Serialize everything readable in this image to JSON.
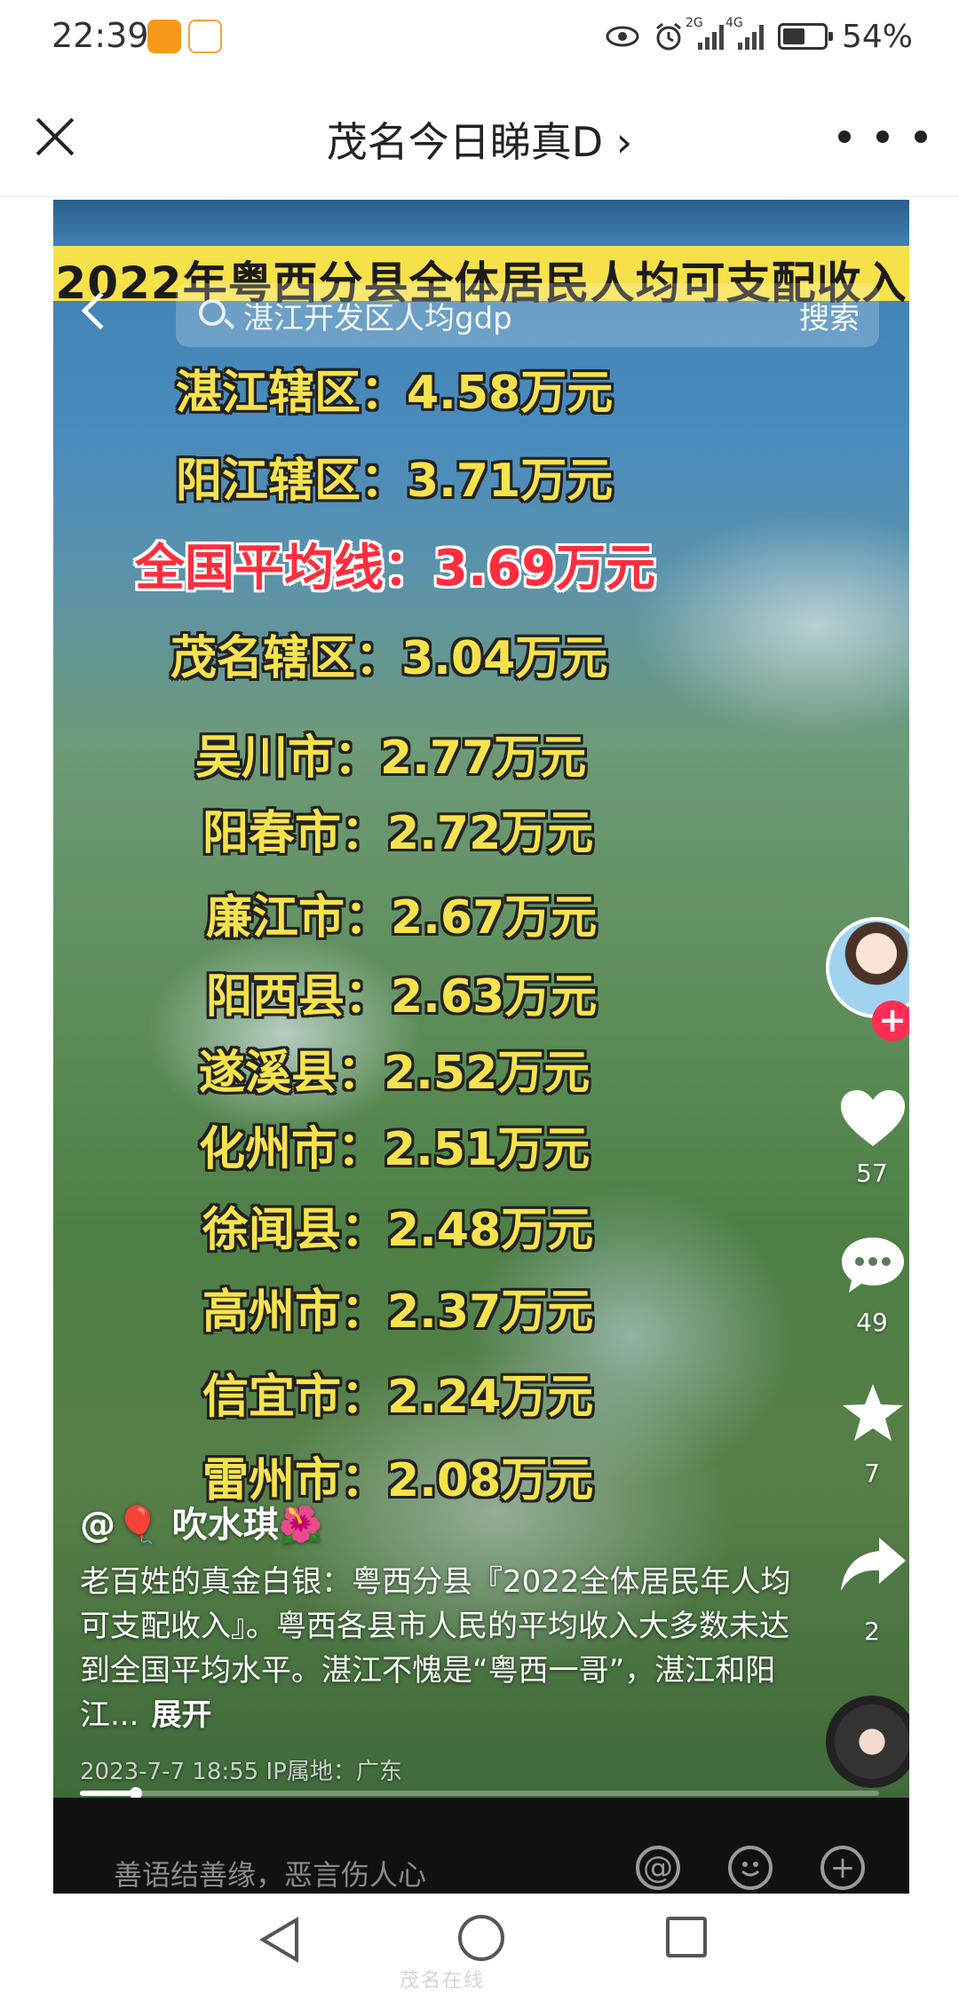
{
  "status_bar": {
    "time": "22:39",
    "network": "2G",
    "network2": "4G",
    "battery_text": "54%",
    "battery_level": 0.54
  },
  "title_bar": {
    "title": "茂名今日睇真D ›"
  },
  "video": {
    "banner": "2022年粤西分县全体居民人均可支配收入",
    "search": {
      "placeholder": "湛江开发区人均gdp",
      "button": "搜索"
    },
    "rankings": [
      {
        "label": "湛江辖区：4.58万元"
      },
      {
        "label": "阳江辖区：3.71万元"
      },
      {
        "label": "全国平均线：3.69万元",
        "highlight": true
      },
      {
        "label": "茂名辖区：3.04万元"
      },
      {
        "label": "吴川市：2.77万元"
      },
      {
        "label": "阳春市：2.72万元"
      },
      {
        "label": "廉江市：2.67万元"
      },
      {
        "label": "阳西县：2.63万元"
      },
      {
        "label": "遂溪县：2.52万元"
      },
      {
        "label": "化州市：2.51万元"
      },
      {
        "label": "徐闻县：2.48万元"
      },
      {
        "label": "高州市：2.37万元"
      },
      {
        "label": "信宜市：2.24万元"
      },
      {
        "label": "雷州市：2.08万元"
      }
    ],
    "actions": {
      "likes": "57",
      "comments": "49",
      "favorites": "7",
      "shares": "2"
    },
    "caption": {
      "author": "@🎈 吹水琪🌺",
      "description": "老百姓的真金白银：粤西分县『2022全体居民年人均可支配收入』。粤西各县市人民的平均收入大多数未达到全国平均水平。湛江不愧是“粤西一哥”，湛江和阳江...",
      "expand": "展开",
      "meta": "2023-7-7 18:55  IP属地：广东"
    },
    "progress": 0.07
  },
  "comment_bar": {
    "placeholder": "善语结善缘，恶言伤人心"
  },
  "nav_bar": {
    "watermark": "茂名在线"
  }
}
